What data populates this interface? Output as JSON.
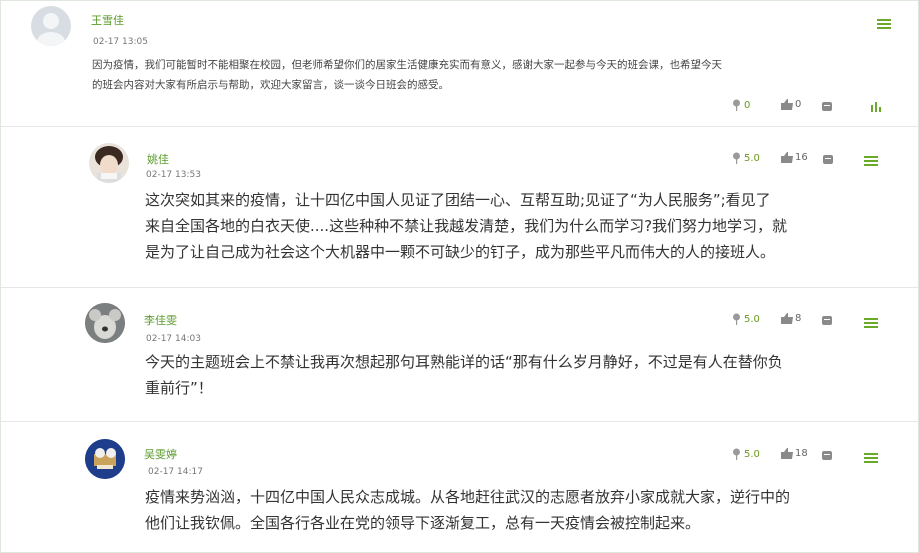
{
  "main_post": {
    "author": "王雪佳",
    "time": "02-17 13:05",
    "line1": "因为疫情，我们可能暂时不能相聚在校园，但老师希望你们的居家生活健康充实而有意义，感谢大家一起参与今天的班会课，也希望今天",
    "line2": "的班会内容对大家有所启示与帮助，欢迎大家留言，谈一谈今日班会的感受。",
    "score": "0",
    "likes": "0"
  },
  "replies": [
    {
      "author": "姚佳",
      "time": "02-17 13:53",
      "lines": [
        "这次突如其来的疫情，让十四亿中国人见证了团结一心、互帮互助;见证了“为人民服务”;看见了",
        "来自全国各地的白衣天使....这些种种不禁让我越发清楚，我们为什么而学习?我们努力地学习，就",
        "是为了让自己成为社会这个大机器中一颗不可缺少的钉子，成为那些平凡而伟大的人的接班人。"
      ],
      "score": "5.0",
      "likes": "16"
    },
    {
      "author": "李佳雯",
      "time": "02-17 14:03",
      "lines": [
        "今天的主题班会上不禁让我再次想起那句耳熟能详的话“那有什么岁月静好，不过是有人在替你负",
        "重前行”！"
      ],
      "score": "5.0",
      "likes": "8"
    },
    {
      "author": "吴雯婷",
      "time": "02-17 14:17",
      "lines": [
        "疫情来势汹汹，十四亿中国人民众志成城。从各地赶往武汉的志愿者放弃小家成就大家，逆行中的",
        "他们让我钦佩。全国各行各业在党的领导下逐渐复工，总有一天疫情会被控制起来。"
      ],
      "score": "5.0",
      "likes": "18"
    }
  ],
  "colors": {
    "accent": "#6aaa2a",
    "name": "#5a9a2a"
  },
  "icons": {
    "score": "flower-icon",
    "like": "thumbs-up-icon",
    "comment": "comment-icon",
    "reply": "reply-icon",
    "menu": "menu-icon"
  }
}
